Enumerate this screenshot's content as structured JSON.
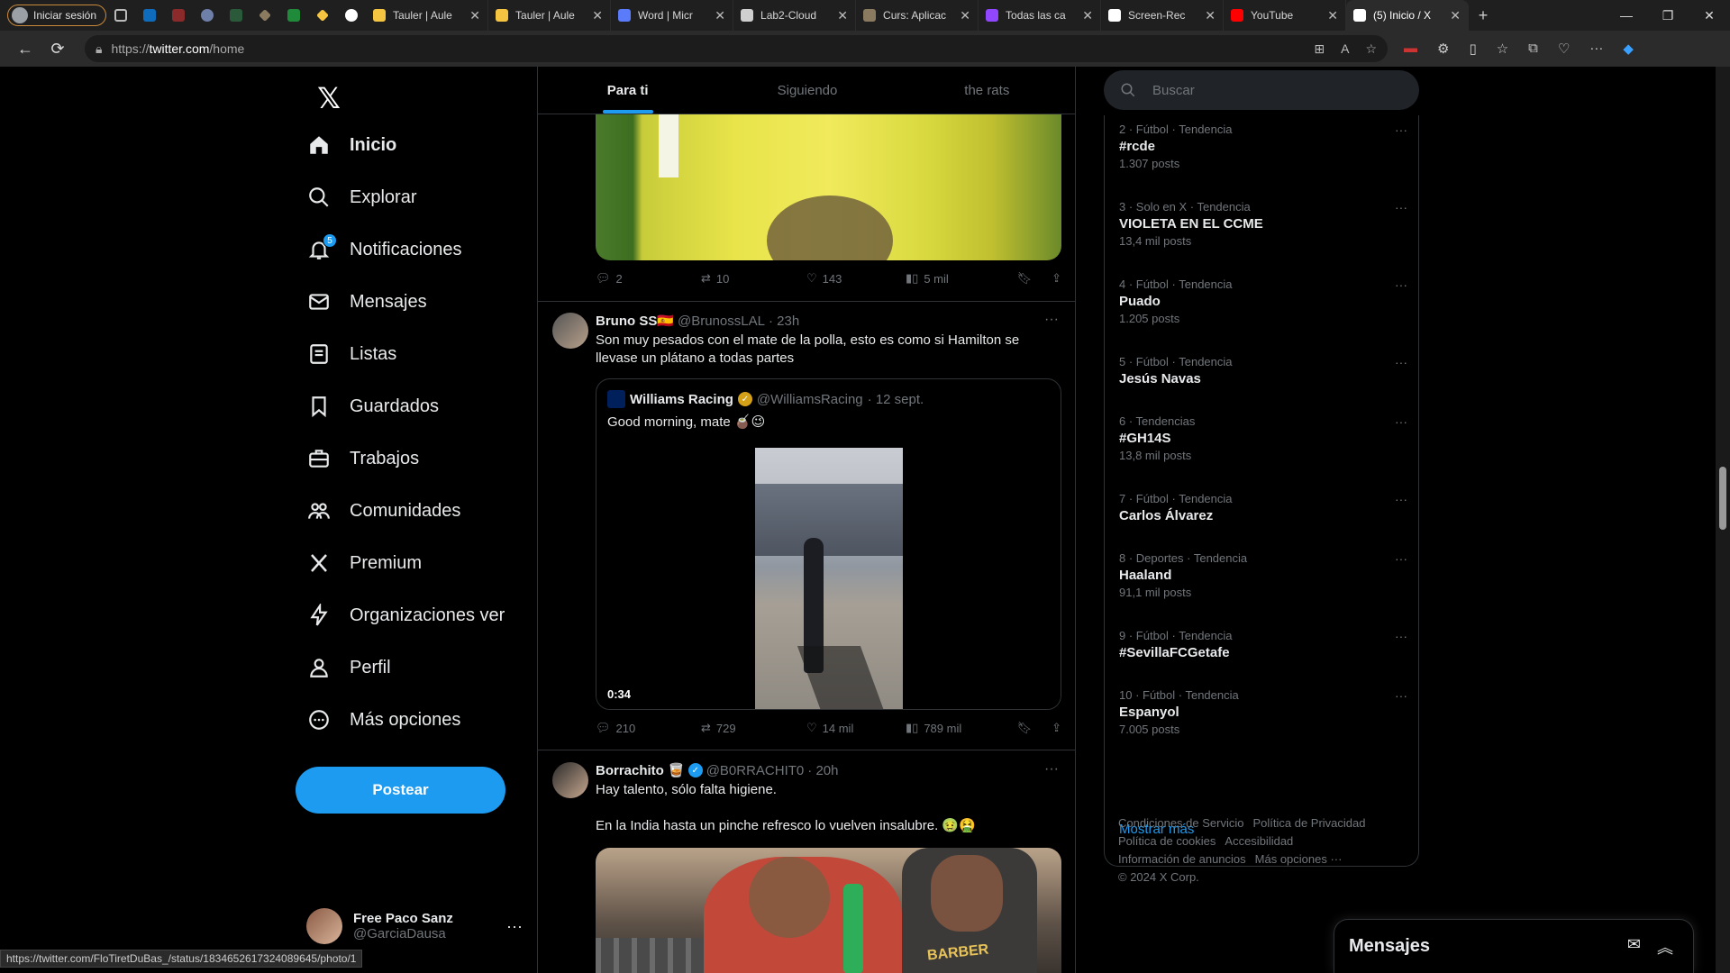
{
  "browser": {
    "profile_label": "Iniciar sesión",
    "tabs": [
      {
        "title": "Tauler | Aule",
        "color": "#f5c542"
      },
      {
        "title": "Tauler | Aule",
        "color": "#f5c542"
      },
      {
        "title": "Word | Micr",
        "color": "#5b7cfa"
      },
      {
        "title": "Lab2-Cloud",
        "color": "#cfcfcf"
      },
      {
        "title": "Curs: Aplicac",
        "color": "#8a7a60"
      },
      {
        "title": "Todas las ca",
        "color": "#9146ff"
      },
      {
        "title": "Screen-Rec",
        "color": "#ffffff"
      },
      {
        "title": "YouTube",
        "color": "#ff0000"
      },
      {
        "title": "(5) Inicio / X",
        "color": "#ffffff"
      }
    ],
    "url_prefix": "https://",
    "url_domain": "twitter.com",
    "url_path": "/home",
    "status_url": "https://twitter.com/FloTiretDuBas_/status/1834652617324089645/photo/1"
  },
  "sidebar": {
    "items": [
      {
        "label": "Inicio",
        "icon": "home-icon"
      },
      {
        "label": "Explorar",
        "icon": "search-icon"
      },
      {
        "label": "Notificaciones",
        "icon": "bell-icon",
        "badge": "5"
      },
      {
        "label": "Mensajes",
        "icon": "mail-icon"
      },
      {
        "label": "Listas",
        "icon": "list-icon"
      },
      {
        "label": "Guardados",
        "icon": "bookmark-icon"
      },
      {
        "label": "Trabajos",
        "icon": "briefcase-icon"
      },
      {
        "label": "Comunidades",
        "icon": "people-icon"
      },
      {
        "label": "Premium",
        "icon": "x-icon"
      },
      {
        "label": "Organizaciones ver",
        "icon": "lightning-icon"
      },
      {
        "label": "Perfil",
        "icon": "person-icon"
      },
      {
        "label": "Más opciones",
        "icon": "more-circle-icon"
      }
    ],
    "post_label": "Postear",
    "account": {
      "name": "Free Paco Sanz",
      "handle": "@GarciaDausa"
    }
  },
  "feed": {
    "tabs": [
      "Para ti",
      "Siguiendo",
      "the rats"
    ],
    "tweet1_actions": {
      "replies": "2",
      "retweets": "10",
      "likes": "143",
      "views": "5 mil"
    },
    "tweet2": {
      "name": "Bruno SS🇪🇸",
      "handle": "@BrunossLAL",
      "time": "· 23h",
      "text": "Son muy pesados con el mate de la polla, esto es como si Hamilton se llevase un plátano a todas partes",
      "quote": {
        "name": "Williams Racing",
        "handle": "@WilliamsRacing",
        "time": "· 12 sept.",
        "text": "Good morning, mate 🧉😉",
        "duration": "0:34"
      },
      "actions": {
        "replies": "210",
        "retweets": "729",
        "likes": "14 mil",
        "views": "789 mil"
      }
    },
    "tweet3": {
      "name": "Borrachito 🥃",
      "handle": "@B0RRACHIT0",
      "time": "· 20h",
      "text1": "Hay talento, sólo falta higiene.",
      "text2": "En la India hasta un pinche refresco lo vuelven insalubre. 🤢🤮",
      "media_text": "BARBER"
    }
  },
  "right": {
    "search_placeholder": "Buscar",
    "trends": [
      {
        "meta": "2 · Fútbol · Tendencia",
        "name": "#rcde",
        "count": "1.307 posts"
      },
      {
        "meta": "3 · Solo en X · Tendencia",
        "name": "VIOLETA EN EL CCME",
        "count": "13,4 mil posts"
      },
      {
        "meta": "4 · Fútbol · Tendencia",
        "name": "Puado",
        "count": "1.205 posts"
      },
      {
        "meta": "5 · Fútbol · Tendencia",
        "name": "Jesús Navas",
        "count": ""
      },
      {
        "meta": "6 · Tendencias",
        "name": "#GH14S",
        "count": "13,8 mil posts"
      },
      {
        "meta": "7 · Fútbol · Tendencia",
        "name": "Carlos Álvarez",
        "count": ""
      },
      {
        "meta": "8 · Deportes · Tendencia",
        "name": "Haaland",
        "count": "91,1 mil posts"
      },
      {
        "meta": "9 · Fútbol · Tendencia",
        "name": "#SevillaFCGetafe",
        "count": ""
      },
      {
        "meta": "10 · Fútbol · Tendencia",
        "name": "Espanyol",
        "count": "7.005 posts"
      }
    ],
    "show_more": "Mostrar más",
    "footer": [
      "Condiciones de Servicio",
      "Política de Privacidad",
      "Política de cookies",
      "Accesibilidad",
      "Información de anuncios",
      "Más opciones ···",
      "© 2024 X Corp."
    ],
    "messages_title": "Mensajes"
  },
  "colors": {
    "accent": "#1d9bf0",
    "border": "#2f3336",
    "muted": "#71767b"
  }
}
